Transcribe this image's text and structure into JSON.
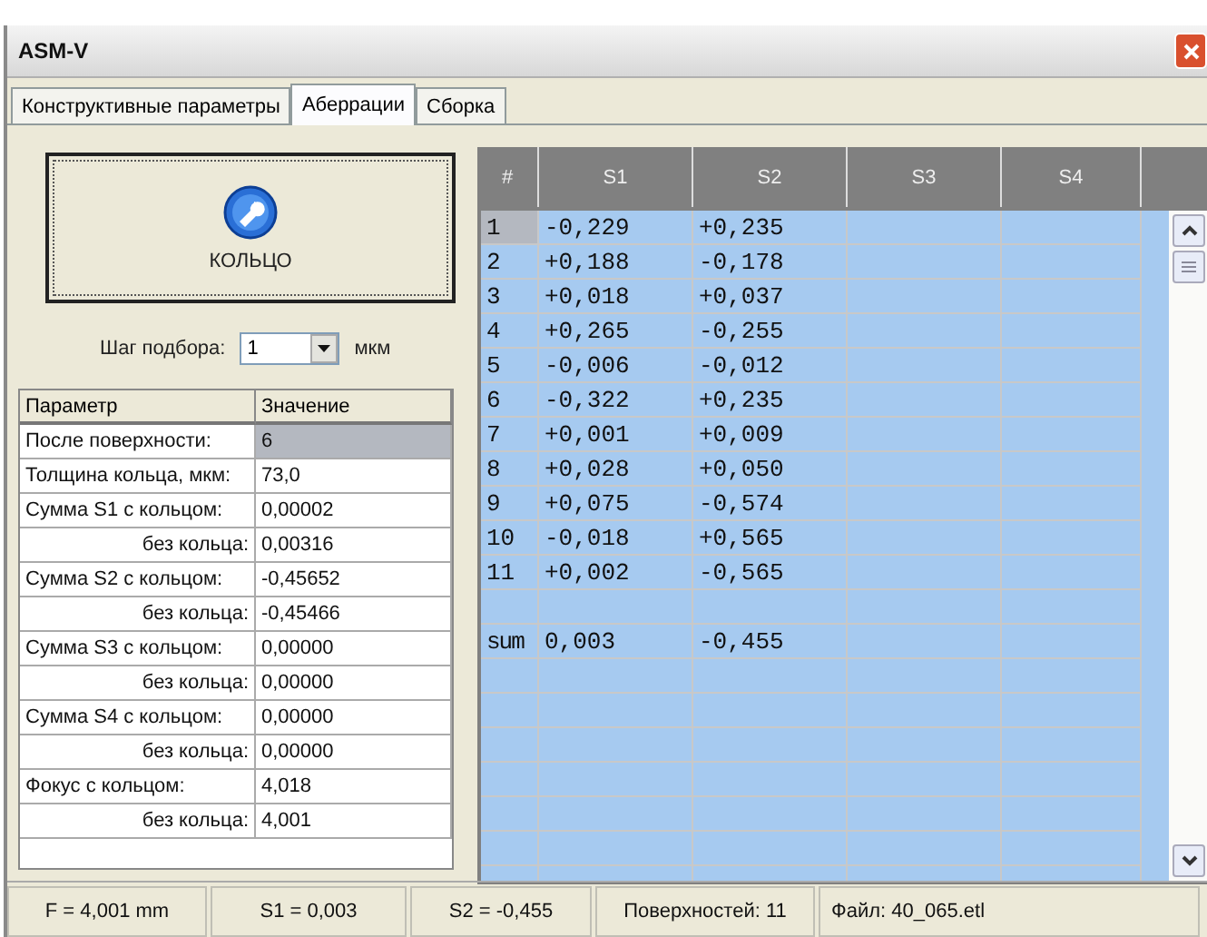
{
  "window": {
    "title": "ASM-V"
  },
  "tabs": [
    {
      "label": "Конструктивные параметры",
      "selected": false
    },
    {
      "label": "Аберрации",
      "selected": true
    },
    {
      "label": "Сборка",
      "selected": false
    }
  ],
  "ring_button": {
    "label": "КОЛЬЦО"
  },
  "step": {
    "label": "Шаг подбора:",
    "value": "1",
    "unit": "мкм"
  },
  "params": {
    "columns": [
      "Параметр",
      "Значение"
    ],
    "rows": [
      {
        "kind": "main",
        "label": "После поверхности:",
        "value": "6",
        "selected": true
      },
      {
        "kind": "main",
        "label": "Толщина кольца, мкм:",
        "value": "73,0",
        "selected": false
      },
      {
        "kind": "main",
        "label": "Сумма S1 с кольцом:",
        "value": "0,00002",
        "selected": false
      },
      {
        "kind": "sub",
        "label": "без кольца:",
        "value": "0,00316",
        "selected": false
      },
      {
        "kind": "main",
        "label": "Сумма S2 с кольцом:",
        "value": "-0,45652",
        "selected": false
      },
      {
        "kind": "sub",
        "label": "без кольца:",
        "value": "-0,45466",
        "selected": false
      },
      {
        "kind": "main",
        "label": "Сумма S3 с кольцом:",
        "value": "0,00000",
        "selected": false
      },
      {
        "kind": "sub",
        "label": "без кольца:",
        "value": "0,00000",
        "selected": false
      },
      {
        "kind": "main",
        "label": "Сумма S4 с кольцом:",
        "value": "0,00000",
        "selected": false
      },
      {
        "kind": "sub",
        "label": "без кольца:",
        "value": "0,00000",
        "selected": false
      },
      {
        "kind": "main",
        "label": "Фокус с кольцом:",
        "value": "4,018",
        "selected": false
      },
      {
        "kind": "sub",
        "label": "без кольца:",
        "value": "4,001",
        "selected": false
      }
    ]
  },
  "grid": {
    "columns": [
      "#",
      "S1",
      "S2",
      "S3",
      "S4"
    ],
    "rows": [
      {
        "kind": "data",
        "n": "1",
        "s1": "-0,229",
        "s2": "+0,235",
        "selected": true
      },
      {
        "kind": "data",
        "n": "2",
        "s1": "+0,188",
        "s2": "-0,178",
        "selected": false
      },
      {
        "kind": "data",
        "n": "3",
        "s1": "+0,018",
        "s2": "+0,037",
        "selected": false
      },
      {
        "kind": "data",
        "n": "4",
        "s1": "+0,265",
        "s2": "-0,255",
        "selected": false
      },
      {
        "kind": "data",
        "n": "5",
        "s1": "-0,006",
        "s2": "-0,012",
        "selected": false
      },
      {
        "kind": "data",
        "n": "6",
        "s1": "-0,322",
        "s2": "+0,235",
        "selected": false
      },
      {
        "kind": "data",
        "n": "7",
        "s1": "+0,001",
        "s2": "+0,009",
        "selected": false
      },
      {
        "kind": "data",
        "n": "8",
        "s1": "+0,028",
        "s2": "+0,050",
        "selected": false
      },
      {
        "kind": "data",
        "n": "9",
        "s1": "+0,075",
        "s2": "-0,574",
        "selected": false
      },
      {
        "kind": "data",
        "n": "10",
        "s1": "-0,018",
        "s2": "+0,565",
        "selected": false
      },
      {
        "kind": "data",
        "n": "11",
        "s1": "+0,002",
        "s2": "-0,565",
        "selected": false
      },
      {
        "kind": "sum",
        "n": "sum",
        "s1": "0,003",
        "s2": "-0,455",
        "selected": false
      }
    ]
  },
  "status_bar": [
    "F = 4,001 mm",
    "S1 = 0,003",
    "S2 = -0,455",
    "Поверхностей: 11",
    "Файл: 40_065.etl"
  ]
}
